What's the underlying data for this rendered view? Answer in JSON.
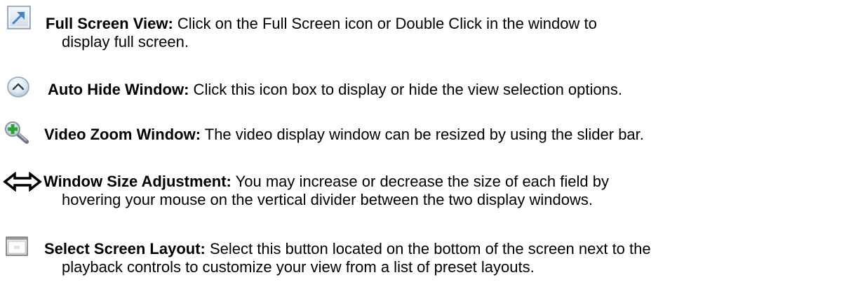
{
  "entries": [
    {
      "icon": "full-screen-icon",
      "term": "Full Screen View:",
      "line1": " Click on the Full Screen icon or Double Click in the window to",
      "line2": "display full screen."
    },
    {
      "icon": "auto-hide-icon",
      "term": "Auto Hide Window:",
      "line1": " Click this icon box to display or hide the view selection options."
    },
    {
      "icon": "zoom-magnifier-icon",
      "term": "Video Zoom Window:",
      "line1": "  The video display window can be resized by using the slider bar."
    },
    {
      "icon": "resize-arrows-icon",
      "term": "Window Size Adjustment:",
      "line1": "  You may increase or decrease the size of each field by",
      "line2": "hovering your mouse on the vertical divider between the two display windows."
    },
    {
      "icon": "screen-layout-icon",
      "term": "Select Screen Layout:",
      "line1": "  Select this button located on the bottom of the screen next to the",
      "line2": "playback controls to customize your view from a list of preset layouts."
    }
  ]
}
